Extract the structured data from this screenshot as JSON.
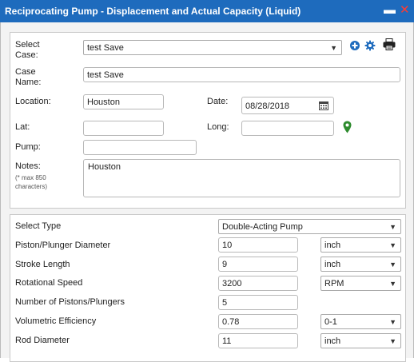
{
  "window": {
    "title": "Reciprocating Pump - Displacement and Actual Capacity (Liquid)",
    "minimize_glyph": "▬",
    "close_glyph": "✕"
  },
  "case_panel": {
    "select_case_label": "Select\nCase:",
    "select_case_value": "test Save",
    "case_name_label": "Case\nName:",
    "case_name_value": "test Save",
    "location_label": "Location:",
    "location_value": "Houston",
    "date_label": "Date:",
    "date_value": "08/28/2018",
    "lat_label": "Lat:",
    "lat_value": "",
    "long_label": "Long:",
    "long_value": "",
    "pump_label": "Pump:",
    "pump_value": "",
    "notes_label": "Notes:",
    "notes_hint": "(* max 850\ncharacters)",
    "notes_value": "Houston",
    "icons": [
      "add-icon",
      "gear-icon",
      "print-icon",
      "calendar-icon",
      "map-pin-icon"
    ]
  },
  "params_panel": {
    "select_type_label": "Select Type",
    "select_type_value": "Double-Acting Pump",
    "rows": [
      {
        "label": "Piston/Plunger Diameter",
        "value": "10",
        "unit": "inch"
      },
      {
        "label": "Stroke Length",
        "value": "9",
        "unit": "inch"
      },
      {
        "label": "Rotational Speed",
        "value": "3200",
        "unit": "RPM"
      },
      {
        "label": "Number of Pistons/Plungers",
        "value": "5",
        "unit": ""
      },
      {
        "label": "Volumetric Efficiency",
        "value": "0.78",
        "unit": "0-1"
      },
      {
        "label": "Rod Diameter",
        "value": "11",
        "unit": "inch"
      }
    ]
  },
  "colors": {
    "titlebar": "#1e6bbd",
    "accent_blue": "#1e6bbd",
    "map_pin_green": "#2e8b2e",
    "close_red": "#ff3b30"
  }
}
